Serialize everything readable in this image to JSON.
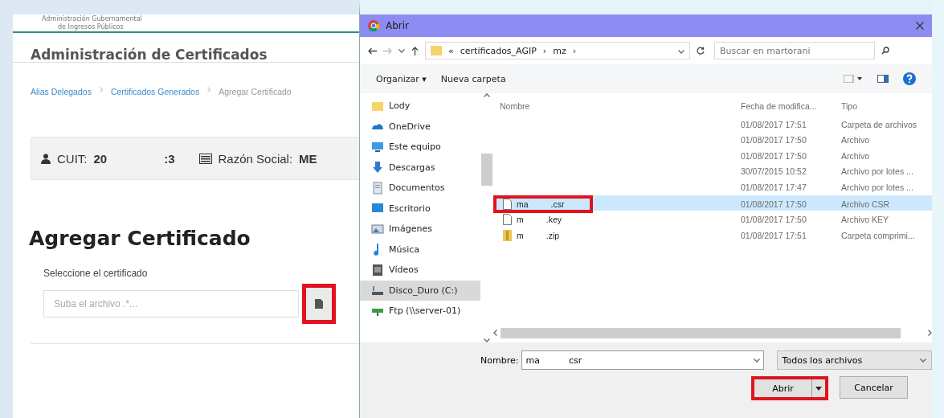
{
  "page": {
    "agency_line_1": "Administración Gubernamental",
    "agency_line_2": "de Ingresos Públicos",
    "title": "Administración de Certificados",
    "breadcrumbs": [
      {
        "label": "Alias Delegados",
        "kind": "link"
      },
      {
        "label": "Certificados Generados",
        "kind": "link"
      },
      {
        "label": "Agregar Certificado",
        "kind": "current"
      }
    ],
    "info": {
      "cuit_label": "CUIT:",
      "cuit_start": "20",
      "cuit_end": ":3",
      "razon_label": "Razón Social:",
      "razon_value": "ME"
    },
    "heading": "Agregar Certificado",
    "field_label": "Seleccione el certificado",
    "file_field": {
      "placeholder": "Suba el archivo .*..."
    },
    "browse_highlighted": true
  },
  "dialog": {
    "title": "Abrir",
    "path": [
      "«",
      "certificados_AGIP",
      "›",
      "mz",
      "›"
    ],
    "search": {
      "placeholder": "Buscar en martorani"
    },
    "toolbar": [
      "Organizar ▾",
      "Nueva carpeta"
    ],
    "nav": [
      {
        "label": "Lody",
        "kind": "folder",
        "selected": false
      },
      {
        "label": "OneDrive",
        "kind": "cloud",
        "selected": false
      },
      {
        "label": "Este equipo",
        "kind": "pc",
        "selected": false
      },
      {
        "label": "Descargas",
        "kind": "download",
        "selected": false
      },
      {
        "label": "Documentos",
        "kind": "docs",
        "selected": false
      },
      {
        "label": "Escritorio",
        "kind": "desktop",
        "selected": false
      },
      {
        "label": "Imágenes",
        "kind": "images",
        "selected": false
      },
      {
        "label": "Música",
        "kind": "music",
        "selected": false
      },
      {
        "label": "Vídeos",
        "kind": "video",
        "selected": false
      },
      {
        "label": "Disco_Duro (C:)",
        "kind": "drive",
        "selected": true
      },
      {
        "label": "Ftp (\\\\server-01)",
        "kind": "network",
        "selected": false
      }
    ],
    "columns": [
      "Nombre",
      "Fecha de modifica...",
      "Tipo"
    ],
    "files": [
      {
        "kind": "blank",
        "date": "01/08/2017 17:51",
        "type": "Carpeta de archivos",
        "selected": false
      },
      {
        "kind": "blank",
        "date": "01/08/2017 17:50",
        "type": "Archivo",
        "selected": false
      },
      {
        "kind": "blank",
        "date": "01/08/2017 17:50",
        "type": "Archivo",
        "selected": false
      },
      {
        "kind": "blank",
        "date": "30/07/2015 10:52",
        "type": "Archivo por lotes ...",
        "selected": false
      },
      {
        "kind": "blank",
        "date": "01/08/2017 17:47",
        "type": "Archivo por lotes ...",
        "selected": false
      },
      {
        "kind": "file",
        "name_start": "ma",
        "name_end": ".csr",
        "date": "01/08/2017 17:50",
        "type": "Archivo CSR",
        "selected": true,
        "highlighted": true
      },
      {
        "kind": "file",
        "name_start": "m",
        "name_end": ".key",
        "date": "01/08/2017 17:50",
        "type": "Archivo KEY",
        "selected": false,
        "highlighted": false
      },
      {
        "kind": "zip",
        "name_start": "m",
        "name_end": ".zip",
        "date": "01/08/2017 17:51",
        "type": "Carpeta comprimi...",
        "selected": false,
        "highlighted": false
      }
    ],
    "name_label": "Nombre:",
    "name_value_start": "ma",
    "name_value_end": "csr",
    "filter": "Todos los archivos",
    "open_button": {
      "label": "Abrir",
      "highlighted": true
    },
    "cancel_button": "Cancelar"
  }
}
